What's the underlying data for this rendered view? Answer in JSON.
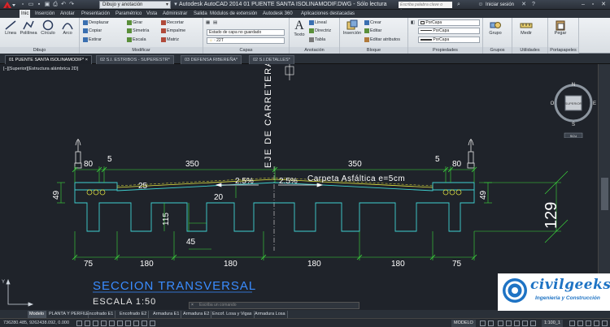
{
  "titlebar": {
    "workspace": "Dibujo y anotación",
    "app_title": "Autodesk AutoCAD 2014    01 PUENTE SANTA ISOLINAMODIF.DWG - Sólo lectura",
    "search_placeholder": "Escriba palabra clave o frase",
    "signin": "Iniciar sesión"
  },
  "menu_tabs": [
    "Inic",
    "Inserción",
    "Anotar",
    "Presentación",
    "Paramétrico",
    "Vista",
    "Administrar",
    "Salida",
    "Módulos de extensión",
    "Autodesk 360",
    "Aplicaciones destacadas"
  ],
  "ribbon": {
    "draw": {
      "label": "Dibujo",
      "tools": [
        "Línea",
        "Polilínea",
        "Círculo",
        "Arco"
      ]
    },
    "modify": {
      "label": "Modificar",
      "tools": [
        "Desplazar",
        "Girar",
        "Recortar",
        "Copiar",
        "Simetría",
        "Empalme",
        "Estirar",
        "Escala",
        "Matriz"
      ]
    },
    "layers": {
      "label": "Capas",
      "state": "Estado de capa no guardado",
      "current": "22T"
    },
    "annotation": {
      "label": "Anotación",
      "text": "Texto",
      "tools": [
        "Lineal",
        "Directriz",
        "Tabla"
      ]
    },
    "block": {
      "label": "Bloque",
      "insert": "Inserción",
      "tools": [
        "Crear",
        "Editar",
        "Editar atributos"
      ]
    },
    "properties": {
      "label": "Propiedades",
      "color": "PorCapa",
      "linetype": "PorCapa",
      "lineweight": "PorCapa"
    },
    "groups": {
      "label": "Grupos",
      "tool": "Grupo"
    },
    "utilities": {
      "label": "Utilidades",
      "tool": "Medir"
    },
    "clipboard": {
      "label": "Portapapeles",
      "tool": "Pegar"
    }
  },
  "doc_tabs": [
    "01 PUENTE SANTA ISOLINAMODIF*",
    "02 S.I. ESTRIBOS - SUPERESTR*",
    "03 DEFENSA RIBEREÑA*",
    "02 S.I.DETALLES*"
  ],
  "viewport_label": "[−][Superior][Estructura alámbrica 2D]",
  "drawing": {
    "axis_label": "EJE DE CARRETERA",
    "top_dims": [
      "80",
      "5",
      "350",
      "350",
      "5",
      "80"
    ],
    "slopes": [
      "2.5%",
      "2.5%"
    ],
    "surface_label": "Carpeta Asfáltica  e=5cm",
    "inner_dims": [
      "25",
      "20",
      "115",
      "45"
    ],
    "side_dims": [
      "49",
      "49",
      "129"
    ],
    "bottom_dims": [
      "75",
      "180",
      "180",
      "180",
      "180",
      "75"
    ],
    "title": "SECCION TRANSVERSAL",
    "scale_text": "ESCALA 1:50"
  },
  "navcube": {
    "n": "N",
    "s": "S",
    "e": "E",
    "o": "O",
    "face": "SUPERIOR",
    "wcs": "SCU"
  },
  "command_placeholder": "Escriba un comando",
  "layout_tabs": [
    "Modelo",
    "PLANTA Y PERFIL",
    "Encofrado E1",
    "Encofrado E2",
    "Armadura E1",
    "Armadura E2",
    "Encof. Losa y Vigas",
    "Armadura Losa"
  ],
  "status": {
    "coords": "736280.485, 9262438.092, 0.000",
    "model": "MODELO",
    "scale": "1:100_1"
  },
  "watermark": {
    "name": "civilgeeks.com",
    "tagline": "Ingeniería y Construcción"
  }
}
